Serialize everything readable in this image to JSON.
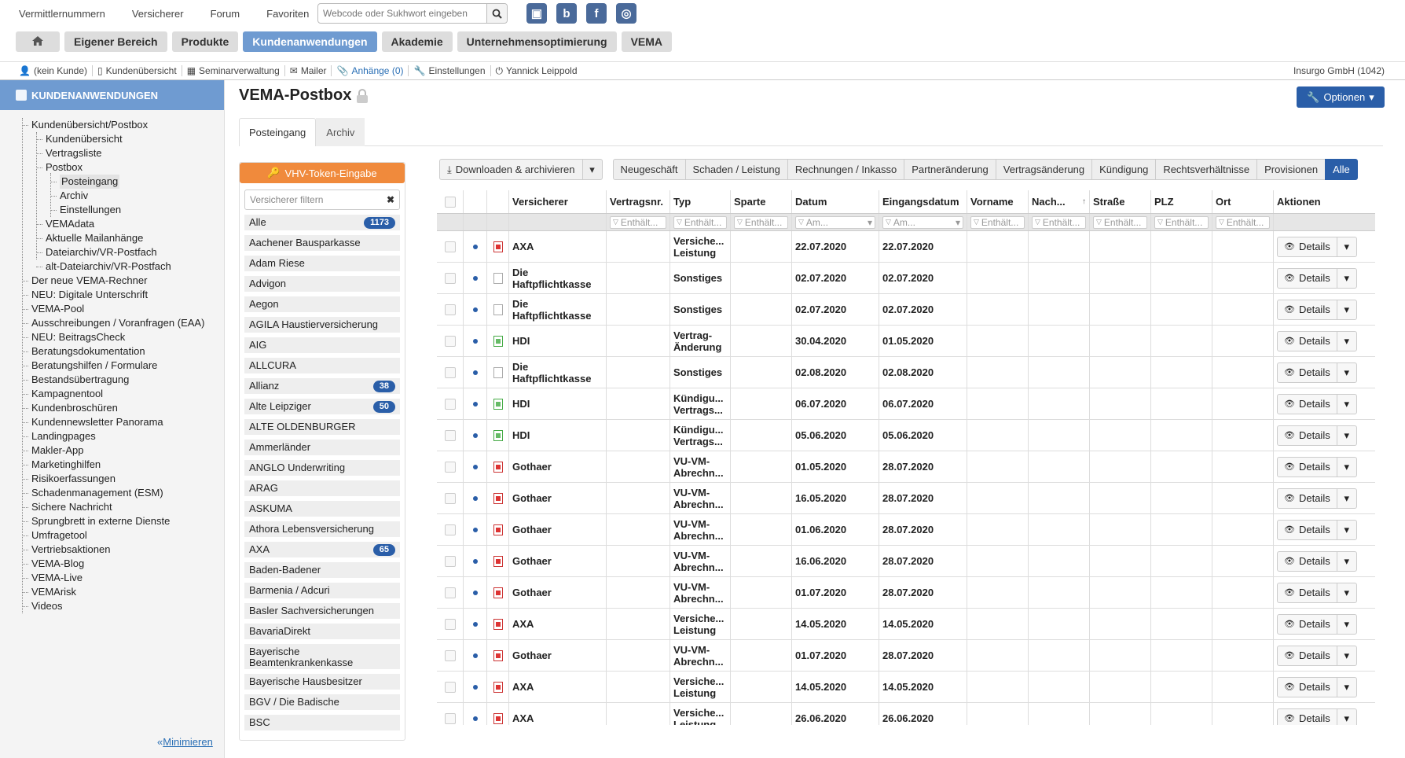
{
  "top_links": [
    "Vermittlernummern",
    "Versicherer",
    "Forum",
    "Favoriten"
  ],
  "search": {
    "placeholder": "Webcode oder Sukhwort eingeben"
  },
  "main_nav": [
    "Eigener Bereich",
    "Produkte",
    "Kundenanwendungen",
    "Akademie",
    "Unternehmensoptimierung",
    "VEMA"
  ],
  "sub_nav": {
    "customer": "(kein Kunde)",
    "overview": "Kundenübersicht",
    "seminars": "Seminarverwaltung",
    "mailer": "Mailer",
    "attachments": "Anhänge (0)",
    "settings": "Einstellungen",
    "user": "Yannick Leippold",
    "company": "Insurgo GmbH (1042)"
  },
  "sidebar": {
    "title": "KUNDENANWENDUNGEN",
    "minimize": "Minimieren",
    "tree": [
      {
        "label": "Kundenübersicht/Postbox",
        "level": 1
      },
      {
        "label": "Kundenübersicht",
        "level": 2
      },
      {
        "label": "Vertragsliste",
        "level": 2
      },
      {
        "label": "Postbox",
        "level": 2
      },
      {
        "label": "Posteingang",
        "level": 3,
        "selected": true
      },
      {
        "label": "Archiv",
        "level": 3
      },
      {
        "label": "Einstellungen",
        "level": 3
      },
      {
        "label": "VEMAdata",
        "level": 2
      },
      {
        "label": "Aktuelle Mailanhänge",
        "level": 2
      },
      {
        "label": "Dateiarchiv/VR-Postfach",
        "level": 2
      },
      {
        "label": "alt-Dateiarchiv/VR-Postfach",
        "level": 2
      },
      {
        "label": "Der neue VEMA-Rechner",
        "level": 1
      },
      {
        "label": "NEU: Digitale Unterschrift",
        "level": 1
      },
      {
        "label": "VEMA-Pool",
        "level": 1
      },
      {
        "label": "Ausschreibungen / Voranfragen (EAA)",
        "level": 1
      },
      {
        "label": "NEU: BeitragsCheck",
        "level": 1
      },
      {
        "label": "Beratungsdokumentation",
        "level": 1
      },
      {
        "label": "Beratungshilfen / Formulare",
        "level": 1
      },
      {
        "label": "Bestandsübertragung",
        "level": 1
      },
      {
        "label": "Kampagnentool",
        "level": 1
      },
      {
        "label": "Kundenbroschüren",
        "level": 1
      },
      {
        "label": "Kundennewsletter Panorama",
        "level": 1
      },
      {
        "label": "Landingpages",
        "level": 1
      },
      {
        "label": "Makler-App",
        "level": 1
      },
      {
        "label": "Marketinghilfen",
        "level": 1
      },
      {
        "label": "Risikoerfassungen",
        "level": 1
      },
      {
        "label": "Schadenmanagement (ESM)",
        "level": 1
      },
      {
        "label": "Sichere Nachricht",
        "level": 1
      },
      {
        "label": "Sprungbrett in externe Dienste",
        "level": 1
      },
      {
        "label": "Umfragetool",
        "level": 1
      },
      {
        "label": "Vertriebsaktionen",
        "level": 1
      },
      {
        "label": "VEMA-Blog",
        "level": 1
      },
      {
        "label": "VEMA-Live",
        "level": 1
      },
      {
        "label": "VEMArisk",
        "level": 1
      },
      {
        "label": "Videos",
        "level": 1
      }
    ]
  },
  "page": {
    "title": "VEMA-Postbox",
    "options": "Optionen"
  },
  "tabs": [
    "Posteingang",
    "Archiv"
  ],
  "filter_panel": {
    "vhv_button": "VHV-Token-Eingabe",
    "filter_placeholder": "Versicherer filtern",
    "insurers": [
      {
        "name": "Alle",
        "count": "1173"
      },
      {
        "name": "Aachener Bausparkasse"
      },
      {
        "name": "Adam Riese"
      },
      {
        "name": "Advigon"
      },
      {
        "name": "Aegon"
      },
      {
        "name": "AGILA Haustierversicherung"
      },
      {
        "name": "AIG"
      },
      {
        "name": "ALLCURA"
      },
      {
        "name": "Allianz",
        "count": "38"
      },
      {
        "name": "Alte Leipziger",
        "count": "50"
      },
      {
        "name": "ALTE OLDENBURGER"
      },
      {
        "name": "Ammerländer"
      },
      {
        "name": "ANGLO Underwriting"
      },
      {
        "name": "ARAG"
      },
      {
        "name": "ASKUMA"
      },
      {
        "name": "Athora Lebensversicherung"
      },
      {
        "name": "AXA",
        "count": "65"
      },
      {
        "name": "Baden-Badener"
      },
      {
        "name": "Barmenia / Adcuri"
      },
      {
        "name": "Basler Sachversicherungen"
      },
      {
        "name": "BavariaDirekt"
      },
      {
        "name": "Bayerische Beamtenkrankenkasse",
        "two": true
      },
      {
        "name": "Bayerische Hausbesitzer"
      },
      {
        "name": "BGV / Die Badische"
      },
      {
        "name": "BSC"
      }
    ]
  },
  "toolbar": {
    "download": "Downloaden & archivieren",
    "filters": [
      "Neugeschäft",
      "Schaden / Leistung",
      "Rechnungen / Inkasso",
      "Partneränderung",
      "Vertragsänderung",
      "Kündigung",
      "Rechtsverhältnisse",
      "Provisionen",
      "Alle"
    ]
  },
  "grid": {
    "columns": [
      "Versicherer",
      "Vertragsnr.",
      "Typ",
      "Sparte",
      "Datum",
      "Eingangsdatum",
      "Vorname",
      "Nach...",
      "Straße",
      "PLZ",
      "Ort",
      "Aktionen"
    ],
    "filter_text": "Enthält...",
    "date_filter_text": "Am...",
    "details_label": "Details",
    "rows": [
      {
        "icon": "pdf",
        "insurer": "AXA",
        "type": "Versiche... Leistung",
        "date": "22.07.2020",
        "received": "22.07.2020"
      },
      {
        "icon": "doc",
        "insurer": "Die Haftpflichtkasse",
        "type": "Sonstiges",
        "date": "02.07.2020",
        "received": "02.07.2020"
      },
      {
        "icon": "doc",
        "insurer": "Die Haftpflichtkasse",
        "type": "Sonstiges",
        "date": "02.07.2020",
        "received": "02.07.2020"
      },
      {
        "icon": "img",
        "insurer": "HDI",
        "type": "Vertrag-Änderung",
        "date": "30.04.2020",
        "received": "01.05.2020"
      },
      {
        "icon": "doc",
        "insurer": "Die Haftpflichtkasse",
        "type": "Sonstiges",
        "date": "02.08.2020",
        "received": "02.08.2020"
      },
      {
        "icon": "img",
        "insurer": "HDI",
        "type": "Kündigu... Vertrags...",
        "date": "06.07.2020",
        "received": "06.07.2020"
      },
      {
        "icon": "img",
        "insurer": "HDI",
        "type": "Kündigu... Vertrags...",
        "date": "05.06.2020",
        "received": "05.06.2020"
      },
      {
        "icon": "pdf",
        "insurer": "Gothaer",
        "type": "VU-VM-Abrechn...",
        "date": "01.05.2020",
        "received": "28.07.2020"
      },
      {
        "icon": "pdf",
        "insurer": "Gothaer",
        "type": "VU-VM-Abrechn...",
        "date": "16.05.2020",
        "received": "28.07.2020"
      },
      {
        "icon": "pdf",
        "insurer": "Gothaer",
        "type": "VU-VM-Abrechn...",
        "date": "01.06.2020",
        "received": "28.07.2020"
      },
      {
        "icon": "pdf",
        "insurer": "Gothaer",
        "type": "VU-VM-Abrechn...",
        "date": "16.06.2020",
        "received": "28.07.2020"
      },
      {
        "icon": "pdf",
        "insurer": "Gothaer",
        "type": "VU-VM-Abrechn...",
        "date": "01.07.2020",
        "received": "28.07.2020"
      },
      {
        "icon": "pdf",
        "insurer": "AXA",
        "type": "Versiche... Leistung",
        "date": "14.05.2020",
        "received": "14.05.2020"
      },
      {
        "icon": "pdf",
        "insurer": "Gothaer",
        "type": "VU-VM-Abrechn...",
        "date": "01.07.2020",
        "received": "28.07.2020"
      },
      {
        "icon": "pdf",
        "insurer": "AXA",
        "type": "Versiche... Leistung",
        "date": "14.05.2020",
        "received": "14.05.2020"
      },
      {
        "icon": "pdf",
        "insurer": "AXA",
        "type": "Versiche... Leistung",
        "date": "26.06.2020",
        "received": "26.06.2020"
      }
    ]
  },
  "colors": {
    "accent": "#2a5ea8",
    "sidebar_header": "#6f9bd1",
    "orange": "#f08a3c"
  }
}
